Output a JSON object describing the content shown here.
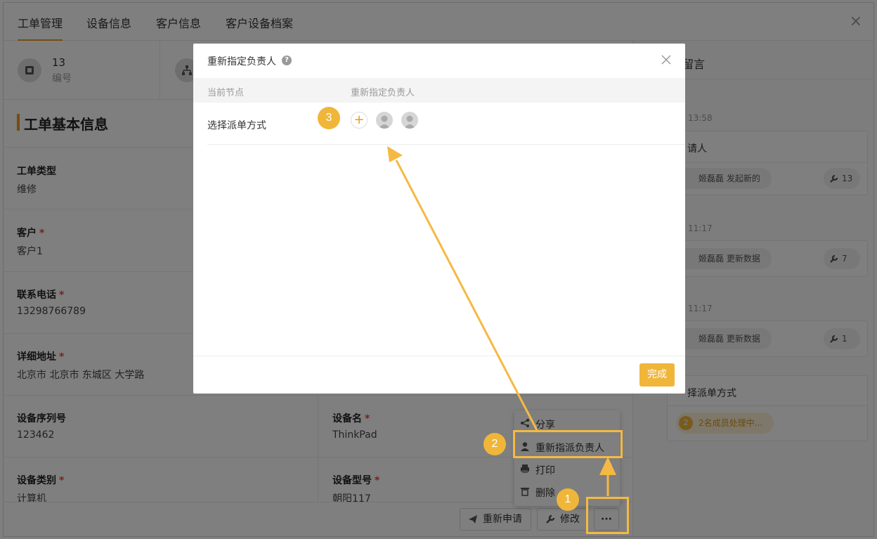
{
  "tabs": [
    {
      "label": "工单管理"
    },
    {
      "label": "设备信息"
    },
    {
      "label": "客户信息"
    },
    {
      "label": "客户设备档案"
    }
  ],
  "close_glyph": "×",
  "info_bar": {
    "number_value": "13",
    "number_label": "编号"
  },
  "section_title": "工单基本信息",
  "fields": {
    "type": {
      "label": "工单类型",
      "value": "维修"
    },
    "customer": {
      "label": "客户",
      "value": "客户1"
    },
    "phone": {
      "label": "联系电话",
      "value": "13298766789"
    },
    "address": {
      "label": "详细地址",
      "value": "北京市 北京市 东城区 大学路"
    },
    "serial": {
      "label": "设备序列号",
      "value": "123462"
    },
    "device_name": {
      "label": "设备名",
      "value": "ThinkPad"
    },
    "category": {
      "label": "设备类别",
      "value": "计算机"
    },
    "model": {
      "label": "设备型号",
      "value": "朝阳117"
    }
  },
  "required_mark": "*",
  "right_panel": {
    "title": "留言",
    "cards": [
      {
        "time": "13:58",
        "title": "请人",
        "pill": "姬磊磊 发起新的",
        "count": "13"
      },
      {
        "time": "11:17",
        "title": "",
        "pill": "姬磊磊 更新数据",
        "count": "7"
      },
      {
        "time": "11:17",
        "title": "",
        "pill": "姬磊磊 更新数据",
        "count": "1"
      }
    ],
    "bottom_card": {
      "title": "择派单方式",
      "badge_num": "2",
      "badge_text": "2名成员处理中..."
    }
  },
  "context_menu": {
    "items": [
      {
        "label": "分享"
      },
      {
        "label": "重新指派负责人"
      },
      {
        "label": "打印"
      },
      {
        "label": "删除"
      }
    ]
  },
  "footer_buttons": {
    "reapply": "重新申请",
    "edit": "修改",
    "more": "···"
  },
  "modal": {
    "title": "重新指定负责人",
    "help_glyph": "?",
    "col_node": "当前节点",
    "col_assignee": "重新指定负责人",
    "row_node": "选择派单方式",
    "add_glyph": "+",
    "done_button": "完成"
  },
  "callouts": [
    "1",
    "2",
    "3"
  ],
  "colors": {
    "accent": "#f0b63a",
    "tab_underline": "#e89a1a",
    "required": "#e8473a",
    "done_button": "#f0b63a"
  }
}
